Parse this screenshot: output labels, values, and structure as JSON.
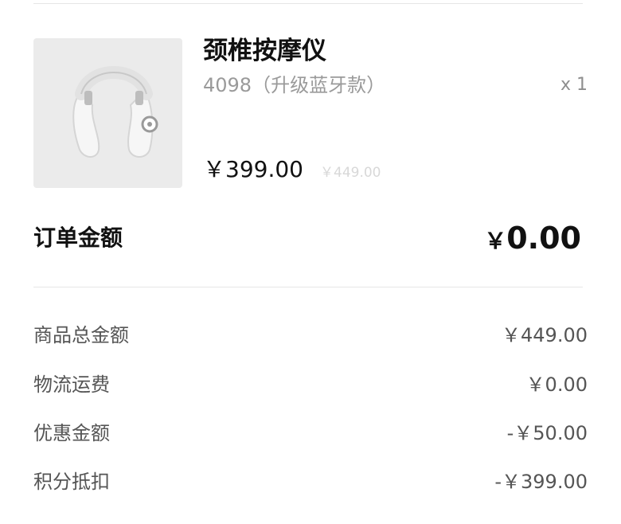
{
  "product": {
    "title": "颈椎按摩仪",
    "variant": "4098（升级蓝牙款）",
    "quantity": "x 1",
    "price": "￥399.00",
    "original_price": "￥449.00",
    "image_icon": "neck-massager"
  },
  "order": {
    "label": "订单金额",
    "currency": "￥",
    "amount": "0.00"
  },
  "summary": [
    {
      "label": "商品总金额",
      "value": "￥449.00"
    },
    {
      "label": "物流运费",
      "value": "￥0.00"
    },
    {
      "label": "优惠金额",
      "value": "-￥50.00"
    },
    {
      "label": "积分抵扣",
      "value": "-￥399.00"
    }
  ]
}
